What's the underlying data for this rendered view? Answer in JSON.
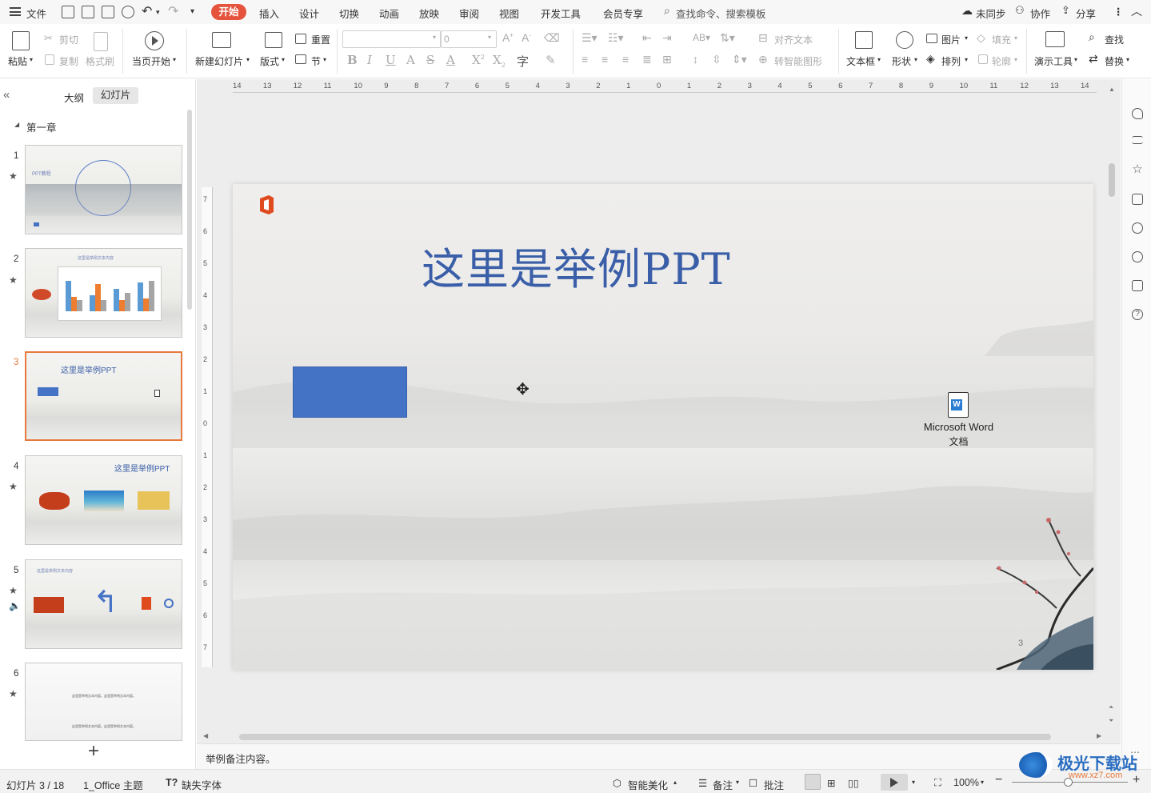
{
  "menu": {
    "file": "文件",
    "tabs": [
      "开始",
      "插入",
      "设计",
      "切换",
      "动画",
      "放映",
      "审阅",
      "视图",
      "开发工具",
      "会员专享"
    ],
    "search": "查找命令、搜索模板",
    "sync": "未同步",
    "collab": "协作",
    "share": "分享"
  },
  "ribbon": {
    "paste": "粘贴",
    "cut": "剪切",
    "copy": "复制",
    "format_painter": "格式刷",
    "from_current": "当页开始",
    "new_slide": "新建幻灯片",
    "layout": "版式",
    "reset": "重置",
    "section": "节",
    "font_size": "0",
    "align_text": "对齐文本",
    "smart_art": "转智能图形",
    "textbox": "文本框",
    "shape": "形状",
    "picture": "图片",
    "fill": "填充",
    "arrange": "排列",
    "outline": "轮廓",
    "present_tools": "演示工具",
    "find": "查找",
    "replace": "替换"
  },
  "panel": {
    "tab_outline": "大纲",
    "tab_slides": "幻灯片",
    "section": "第一章",
    "add": "+",
    "thumbs": [
      {
        "num": "1",
        "text": "PPT教程"
      },
      {
        "num": "2",
        "text": "这里是举例文本内容"
      },
      {
        "num": "3",
        "text": "这里是举例PPT"
      },
      {
        "num": "4",
        "text": "这里是举例PPT"
      },
      {
        "num": "5",
        "text": "这里是举例文本内容"
      },
      {
        "num": "6",
        "text": "这里是举例文本内容。这里是举例文本内容。"
      }
    ]
  },
  "slide": {
    "title": "这里是举例PPT",
    "object_label_1": "Microsoft Word",
    "object_label_2": "文档",
    "page_number": "3",
    "rect_color": "#4472c4",
    "title_color": "#3a5fa8"
  },
  "notes": "举例备注内容。",
  "status": {
    "slide_info": "幻灯片 3 / 18",
    "theme": "1_Office 主题",
    "missing_font": "缺失字体",
    "beautify": "智能美化",
    "notes": "备注",
    "comment": "批注",
    "zoom": "100%"
  },
  "ruler": {
    "h_labels": [
      "14",
      "13",
      "12",
      "11",
      "10",
      "9",
      "8",
      "7",
      "6",
      "5",
      "4",
      "3",
      "2",
      "1",
      "0",
      "1",
      "2",
      "3",
      "4",
      "5",
      "6",
      "7",
      "8",
      "9",
      "10",
      "11",
      "12",
      "13",
      "14"
    ],
    "v_labels": [
      "7",
      "6",
      "5",
      "4",
      "3",
      "2",
      "1",
      "0",
      "1",
      "2",
      "3",
      "4",
      "5",
      "6",
      "7"
    ]
  },
  "watermark": "极光下载站",
  "watermark_url": "www.xz7.com",
  "colors": {
    "accent": "#e5533c",
    "selection": "#e8793d"
  }
}
